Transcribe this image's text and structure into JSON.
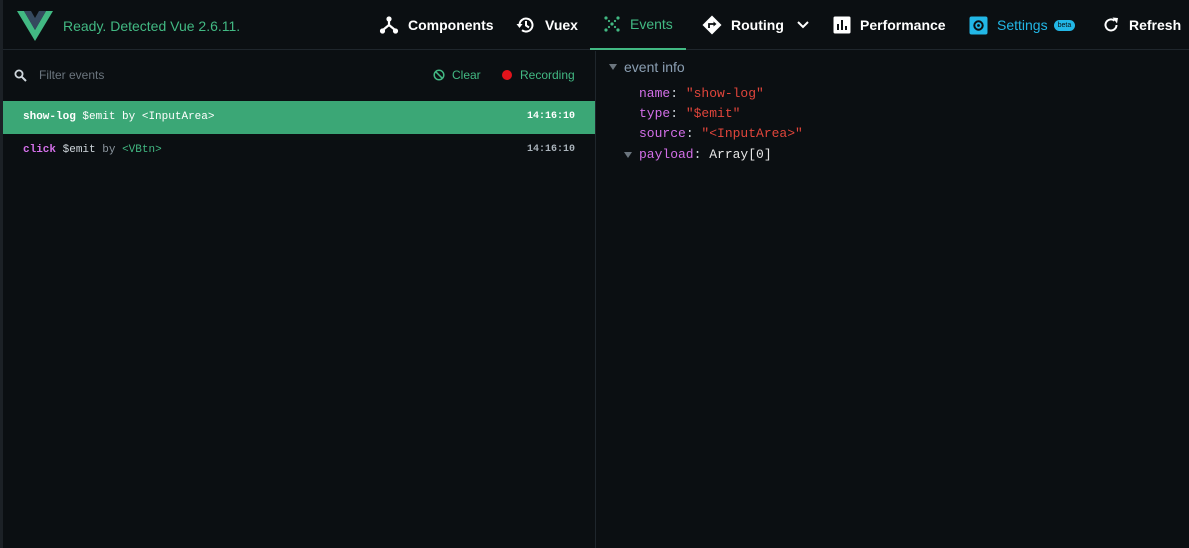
{
  "header": {
    "status": "Ready. Detected Vue 2.6.11.",
    "nav": {
      "components": "Components",
      "vuex": "Vuex",
      "events": "Events",
      "routing": "Routing",
      "performance": "Performance",
      "settings": "Settings",
      "settings_badge": "beta",
      "refresh": "Refresh"
    },
    "active_tab": "events"
  },
  "events_panel": {
    "filter_placeholder": "Filter events",
    "filter_value": "",
    "clear_label": "Clear",
    "recording_label": "Recording",
    "events": [
      {
        "name": "show-log",
        "type": "$emit",
        "by": "by",
        "component": "<InputArea>",
        "time": "14:16:10",
        "selected": true
      },
      {
        "name": "click",
        "type": "$emit",
        "by": "by",
        "component": "<VBtn>",
        "time": "14:16:10",
        "selected": false
      }
    ]
  },
  "event_info": {
    "title": "event info",
    "name_key": "name",
    "name_value": "\"show-log\"",
    "type_key": "type",
    "type_value": "\"$emit\"",
    "source_key": "source",
    "source_value": "\"<InputArea>\"",
    "payload_key": "payload",
    "payload_value": "Array[0]"
  },
  "colors": {
    "vue_green": "#42b983",
    "selected_row": "#3ba776",
    "settings_blue": "#22b7e6",
    "recording_red": "#e2131b",
    "key_purple": "#d36fe8",
    "string_red": "#e0453b",
    "background": "#0b0f12"
  },
  "icons": {
    "logo": "vue-logo",
    "components": "component-tree-icon",
    "vuex": "history-icon",
    "events": "events-dots-icon",
    "routing": "routing-diamond-icon",
    "performance": "bar-chart-icon",
    "settings": "gear-icon",
    "refresh": "refresh-icon",
    "filter": "search-icon",
    "clear": "block-icon",
    "recording": "record-dot-icon"
  }
}
